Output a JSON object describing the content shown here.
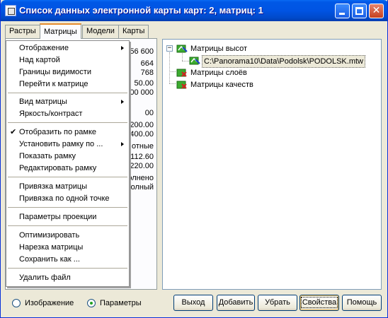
{
  "window": {
    "title": "Список данных электронной карты     карт: 2, матриц: 1"
  },
  "tabs": [
    {
      "label": "Растры"
    },
    {
      "label": "Матрицы"
    },
    {
      "label": "Модели"
    },
    {
      "label": "Карты"
    }
  ],
  "panel_values": [
    "56 600",
    "664",
    "768",
    "50.00",
    "00 000",
    "00",
    "200.00",
    "400.00",
    "отные",
    "112.60",
    "220.00",
    "олнено",
    "олный"
  ],
  "context_menu": {
    "items": [
      {
        "label": "Отображение",
        "submenu": true
      },
      {
        "label": "Над картой"
      },
      {
        "label": "Границы видимости"
      },
      {
        "label": "Перейти к матрице"
      },
      {
        "label": "Вид матрицы",
        "submenu": true
      },
      {
        "label": "Яркость/контраст"
      },
      {
        "label": "Отобразить по рамке",
        "checked": true
      },
      {
        "label": "Установить рамку по ...",
        "submenu": true
      },
      {
        "label": "Показать рамку"
      },
      {
        "label": "Редактировать рамку"
      },
      {
        "label": "Привязка матрицы"
      },
      {
        "label": "Привязка по одной точке"
      },
      {
        "label": "Параметры проекции"
      },
      {
        "label": "Оптимизировать"
      },
      {
        "label": "Нарезка матрицы"
      },
      {
        "label": "Сохранить как ..."
      },
      {
        "label": "Удалить файл"
      }
    ],
    "check_glyph": "✔"
  },
  "tree": {
    "expander_glyph": "−",
    "root": {
      "label": "Матрицы высот",
      "icon": "matrix-height-icon"
    },
    "child": {
      "label": "C:\\Panorama10\\Data\\Podolsk\\PODOLSK.mtw",
      "icon": "matrix-file-icon"
    },
    "siblings": [
      {
        "label": "Матрицы слоёв",
        "icon": "matrix-layers-icon"
      },
      {
        "label": "Матрицы качеств",
        "icon": "matrix-quality-icon"
      }
    ]
  },
  "radios": {
    "image_label": "Изображение",
    "params_label": "Параметры",
    "selected": "params"
  },
  "buttons": {
    "exit": "Выход",
    "add": "Добавить",
    "remove": "Убрать",
    "properties": "Свойства",
    "help": "Помощь"
  },
  "colors": {
    "titlebar": "#0054e3",
    "tab_accent": "#e68b2c",
    "icon_green": "#3cab2f",
    "icon_red": "#d62020"
  }
}
